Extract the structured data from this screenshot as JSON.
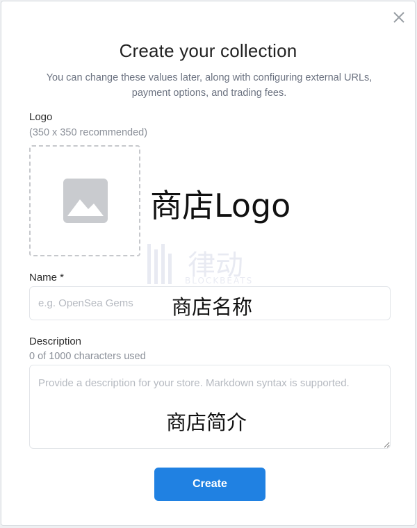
{
  "modal": {
    "title": "Create your collection",
    "subtitle": "You can change these values later, along with configuring external URLs, payment options, and trading fees.",
    "close_icon": "close-icon"
  },
  "logo": {
    "label": "Logo",
    "hint": "(350 x 350 recommended)",
    "placeholder_icon": "image-icon",
    "annotation": "商店Logo"
  },
  "name": {
    "label": "Name *",
    "placeholder": "e.g. OpenSea Gems",
    "value": "",
    "annotation": "商店名称"
  },
  "description": {
    "label": "Description",
    "counter": "0 of 1000 characters used",
    "placeholder": "Provide a description for your store. Markdown syntax is supported.",
    "value": "",
    "annotation": "商店简介"
  },
  "actions": {
    "create_label": "Create",
    "accent_color": "#2081e2"
  },
  "watermark": {
    "text": "律动",
    "sub": "BLOCKBEATS"
  }
}
